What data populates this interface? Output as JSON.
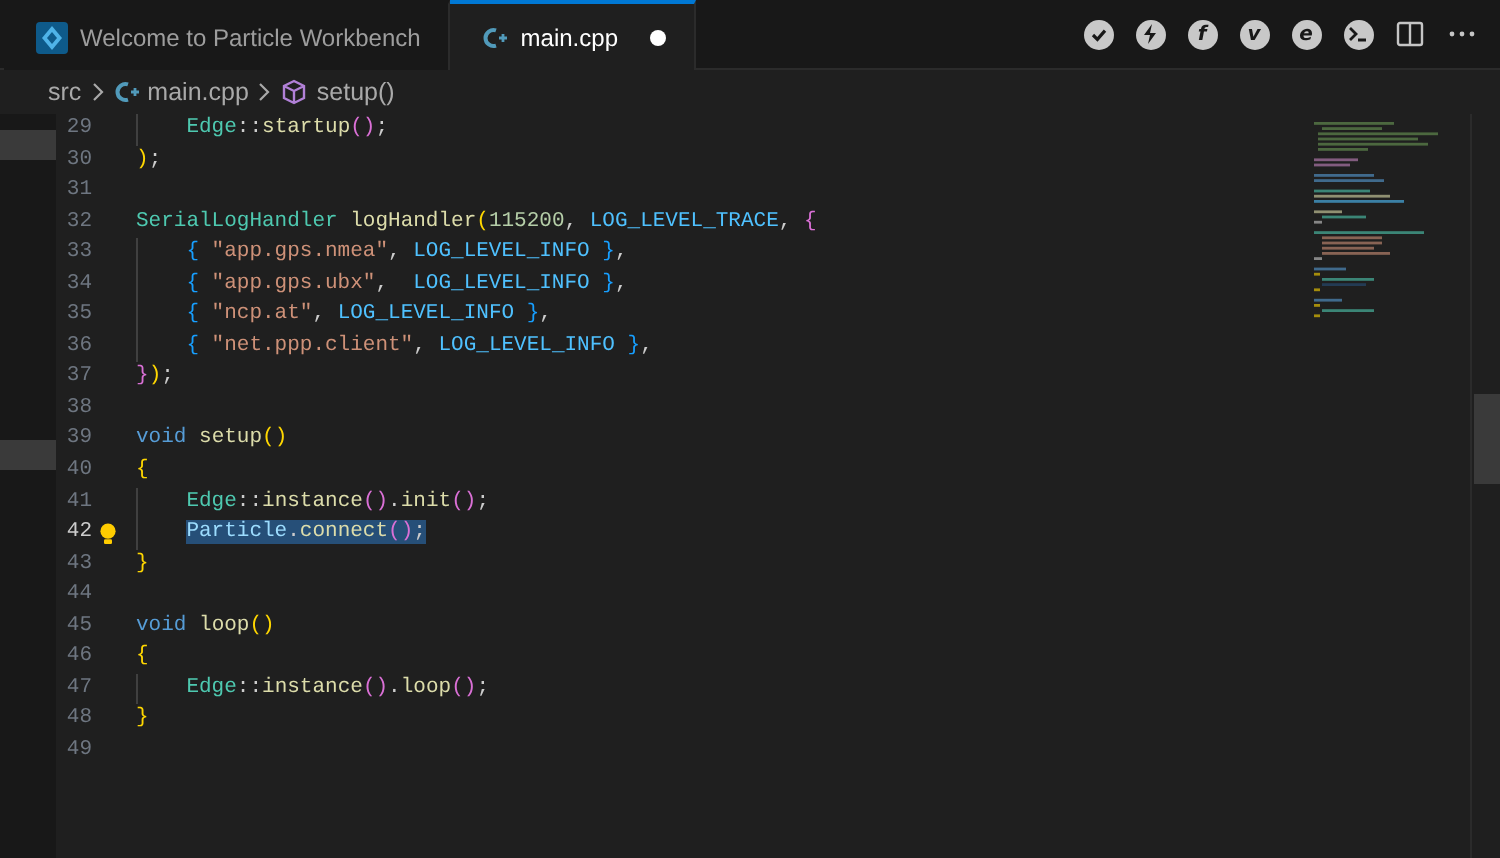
{
  "tabs": [
    {
      "label": "Welcome to Particle Workbench",
      "selected": false,
      "modified": false
    },
    {
      "label": "main.cpp",
      "selected": true,
      "modified": true
    }
  ],
  "toolbar": [
    {
      "kind": "check"
    },
    {
      "kind": "bolt"
    },
    {
      "kind": "letter",
      "label": "f"
    },
    {
      "kind": "letter",
      "label": "v"
    },
    {
      "kind": "letter",
      "label": "e"
    },
    {
      "kind": "terminal"
    },
    {
      "kind": "split"
    },
    {
      "kind": "more"
    }
  ],
  "breadcrumb": [
    {
      "label": "src"
    },
    {
      "label": "main.cpp"
    },
    {
      "label": "setup()"
    }
  ],
  "lines": [
    {
      "number": "29",
      "current": false,
      "indented": true,
      "tokens": [
        {
          "text": "Edge",
          "kind": "type"
        },
        {
          "text": "::",
          "kind": "punct"
        },
        {
          "text": "startup",
          "kind": "func"
        },
        {
          "text": "()",
          "kind": "paren2"
        },
        {
          "text": ";",
          "kind": "punct"
        }
      ]
    },
    {
      "number": "30",
      "current": false,
      "indented": false,
      "tokens": [
        {
          "text": ")",
          "kind": "paren"
        },
        {
          "text": ";",
          "kind": "punct"
        }
      ]
    },
    {
      "number": "31",
      "current": false
    },
    {
      "number": "32",
      "current": false,
      "indented": false,
      "tokens": [
        {
          "text": "SerialLogHandler",
          "kind": "type"
        },
        {
          "text": " logHandler",
          "kind": "func"
        },
        {
          "text": "(",
          "kind": "paren"
        },
        {
          "text": "115200",
          "kind": "number"
        },
        {
          "text": ", ",
          "kind": "punct"
        },
        {
          "text": "LOG_LEVEL_TRACE",
          "kind": "const"
        },
        {
          "text": ", ",
          "kind": "punct"
        },
        {
          "text": "{",
          "kind": "paren2"
        }
      ]
    },
    {
      "number": "33",
      "current": false,
      "indented": true,
      "tokens": [
        {
          "text": "{ ",
          "kind": "paren3"
        },
        {
          "text": "\"app.gps.nmea\"",
          "kind": "string"
        },
        {
          "text": ", ",
          "kind": "punct"
        },
        {
          "text": "LOG_LEVEL_INFO",
          "kind": "const"
        },
        {
          "text": " }",
          "kind": "paren3"
        },
        {
          "text": ",",
          "kind": "punct"
        }
      ]
    },
    {
      "number": "34",
      "current": false,
      "indented": true,
      "tokens": [
        {
          "text": "{ ",
          "kind": "paren3"
        },
        {
          "text": "\"app.gps.ubx\"",
          "kind": "string"
        },
        {
          "text": ",  ",
          "kind": "punct"
        },
        {
          "text": "LOG_LEVEL_INFO",
          "kind": "const"
        },
        {
          "text": " }",
          "kind": "paren3"
        },
        {
          "text": ",",
          "kind": "punct"
        }
      ]
    },
    {
      "number": "35",
      "current": false,
      "indented": true,
      "tokens": [
        {
          "text": "{ ",
          "kind": "paren3"
        },
        {
          "text": "\"ncp.at\"",
          "kind": "string"
        },
        {
          "text": ", ",
          "kind": "punct"
        },
        {
          "text": "LOG_LEVEL_INFO",
          "kind": "const"
        },
        {
          "text": " }",
          "kind": "paren3"
        },
        {
          "text": ",",
          "kind": "punct"
        }
      ]
    },
    {
      "number": "36",
      "current": false,
      "indented": true,
      "tokens": [
        {
          "text": "{ ",
          "kind": "paren3"
        },
        {
          "text": "\"net.ppp.client\"",
          "kind": "string"
        },
        {
          "text": ", ",
          "kind": "punct"
        },
        {
          "text": "LOG_LEVEL_INFO",
          "kind": "const"
        },
        {
          "text": " }",
          "kind": "paren3"
        },
        {
          "text": ",",
          "kind": "punct"
        }
      ]
    },
    {
      "number": "37",
      "current": false,
      "indented": false,
      "tokens": [
        {
          "text": "}",
          "kind": "paren2"
        },
        {
          "text": ")",
          "kind": "paren"
        },
        {
          "text": ";",
          "kind": "punct"
        }
      ]
    },
    {
      "number": "38",
      "current": false
    },
    {
      "number": "39",
      "current": false,
      "indented": false,
      "tokens": [
        {
          "text": "void",
          "kind": "keyword"
        },
        {
          "text": " setup",
          "kind": "func"
        },
        {
          "text": "()",
          "kind": "paren"
        }
      ]
    },
    {
      "number": "40",
      "current": false,
      "indented": false,
      "tokens": [
        {
          "text": "{",
          "kind": "paren"
        }
      ]
    },
    {
      "number": "41",
      "current": false,
      "indented": true,
      "tokens": [
        {
          "text": "Edge",
          "kind": "type"
        },
        {
          "text": "::",
          "kind": "punct"
        },
        {
          "text": "instance",
          "kind": "func"
        },
        {
          "text": "()",
          "kind": "paren2"
        },
        {
          "text": ".",
          "kind": "punct"
        },
        {
          "text": "init",
          "kind": "func"
        },
        {
          "text": "()",
          "kind": "paren2"
        },
        {
          "text": ";",
          "kind": "punct"
        }
      ]
    },
    {
      "number": "42",
      "current": true,
      "indented": true,
      "tokens": [
        {
          "text": "Particle",
          "kind": "var"
        },
        {
          "text": ".",
          "kind": "punct"
        },
        {
          "text": "connect",
          "kind": "func"
        },
        {
          "text": "()",
          "kind": "paren2"
        },
        {
          "text": ";",
          "kind": "punct"
        }
      ]
    },
    {
      "number": "43",
      "current": false,
      "indented": false,
      "tokens": [
        {
          "text": "}",
          "kind": "paren"
        }
      ]
    },
    {
      "number": "44",
      "current": false
    },
    {
      "number": "45",
      "current": false,
      "indented": false,
      "tokens": [
        {
          "text": "void",
          "kind": "keyword"
        },
        {
          "text": " loop",
          "kind": "func"
        },
        {
          "text": "()",
          "kind": "paren"
        }
      ]
    },
    {
      "number": "46",
      "current": false,
      "indented": false,
      "tokens": [
        {
          "text": "{",
          "kind": "paren"
        }
      ]
    },
    {
      "number": "47",
      "current": false,
      "indented": true,
      "tokens": [
        {
          "text": "Edge",
          "kind": "type"
        },
        {
          "text": "::",
          "kind": "punct"
        },
        {
          "text": "instance",
          "kind": "func"
        },
        {
          "text": "()",
          "kind": "paren2"
        },
        {
          "text": ".",
          "kind": "punct"
        },
        {
          "text": "loop",
          "kind": "func"
        },
        {
          "text": "()",
          "kind": "paren2"
        },
        {
          "text": ";",
          "kind": "punct"
        }
      ]
    },
    {
      "number": "48",
      "current": false,
      "indented": false,
      "tokens": [
        {
          "text": "}",
          "kind": "paren"
        }
      ]
    },
    {
      "number": "49",
      "current": false
    }
  ]
}
